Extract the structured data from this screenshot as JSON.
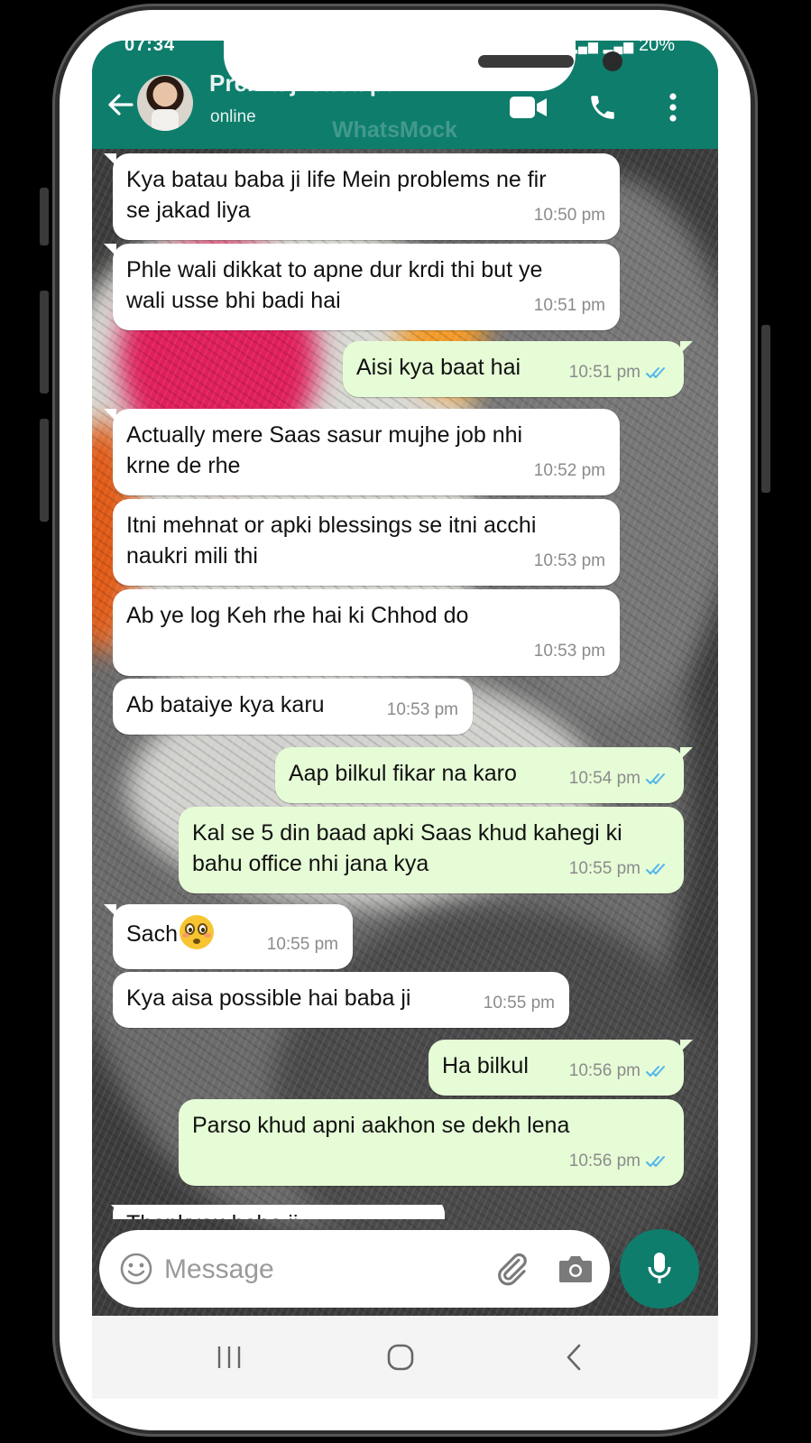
{
  "status_bar": {
    "time": "07:34",
    "battery": "20%"
  },
  "header": {
    "contact_name": "Prerna ji Jabalpur",
    "contact_status": "online",
    "watermark": "WhatsMock"
  },
  "icons": {
    "back": "arrow-left-icon",
    "video_call": "video-camera-icon",
    "voice_call": "phone-icon",
    "menu": "more-vertical-icon",
    "emoji": "emoji-icon",
    "attach": "paperclip-icon",
    "camera": "camera-icon",
    "mic": "microphone-icon",
    "read_receipt": "double-check-icon"
  },
  "colors": {
    "header_bg": "#0e7d6c",
    "incoming_bubble": "#ffffff",
    "outgoing_bubble": "#e6fcd6",
    "read_tick": "#4fb6ec",
    "timestamp": "#8b8b8b"
  },
  "messages": [
    {
      "dir": "in",
      "lines": [
        "Kya batau baba ji life Mein problems ne fir",
        "se jakad liya"
      ],
      "time": "10:50 pm"
    },
    {
      "dir": "in",
      "lines": [
        "Phle wali dikkat to apne dur krdi thi but ye",
        "wali usse bhi badi hai"
      ],
      "time": "10:51 pm"
    },
    {
      "dir": "out",
      "lines": [
        "Aisi kya baat hai"
      ],
      "time": "10:51 pm"
    },
    {
      "dir": "in",
      "lines": [
        "Actually mere Saas sasur mujhe job nhi",
        "krne de rhe"
      ],
      "time": "10:52 pm"
    },
    {
      "dir": "in",
      "lines": [
        "Itni mehnat or apki blessings se itni acchi",
        "naukri mili thi"
      ],
      "time": "10:53 pm"
    },
    {
      "dir": "in",
      "lines": [
        "Ab ye log Keh rhe hai ki Chhod do"
      ],
      "time": "10:53 pm"
    },
    {
      "dir": "in",
      "lines": [
        "Ab bataiye kya karu"
      ],
      "time": "10:53 pm"
    },
    {
      "dir": "out",
      "lines": [
        "Aap bilkul fikar na karo"
      ],
      "time": "10:54 pm"
    },
    {
      "dir": "out",
      "lines": [
        "Kal se 5 din baad apki Saas khud kahegi ki",
        "bahu office nhi jana kya"
      ],
      "time": "10:55 pm"
    },
    {
      "dir": "in",
      "lines": [
        "Sach"
      ],
      "emoji": "flushed-face-icon",
      "time": "10:55 pm"
    },
    {
      "dir": "in",
      "lines": [
        "Kya aisa possible hai baba ji"
      ],
      "time": "10:55 pm"
    },
    {
      "dir": "out",
      "lines": [
        "Ha bilkul"
      ],
      "time": "10:56 pm"
    },
    {
      "dir": "out",
      "lines": [
        "Parso khud apni aakhon se dekh lena"
      ],
      "time": "10:56 pm"
    },
    {
      "dir": "in",
      "lines": [
        "Thankyou baba ji"
      ],
      "time": "",
      "partial": true
    }
  ],
  "composer": {
    "placeholder": "Message"
  },
  "navbar": {
    "recents": "recents-icon",
    "home": "home-icon",
    "back": "nav-back-icon"
  }
}
